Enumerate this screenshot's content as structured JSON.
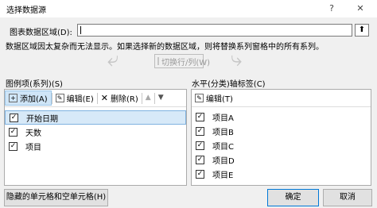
{
  "dialog": {
    "title": "选择数据源",
    "help_glyph": "?",
    "close_glyph": "✕"
  },
  "range": {
    "label": "图表数据区域(D):",
    "value": "",
    "collapse_glyph": "⬆"
  },
  "hint": "数据区域因太复杂而无法显示。如果选择新的数据区域，则将替换系列窗格中的所有系列。",
  "switch_button": {
    "label": "切换行/列(W)"
  },
  "legend": {
    "label": "图例项(系列)(S)",
    "add_label": "添加(A)",
    "edit_label": "编辑(E)",
    "delete_label": "删除(R)",
    "up_glyph": "▲",
    "down_glyph": "▼",
    "items": [
      {
        "label": "开始日期",
        "checked": true
      },
      {
        "label": "天数",
        "checked": true
      },
      {
        "label": "项目",
        "checked": true
      }
    ]
  },
  "axis": {
    "label": "水平(分类)轴标签(C)",
    "edit_label": "编辑(T)",
    "items": [
      {
        "label": "项目A",
        "checked": true
      },
      {
        "label": "项目B",
        "checked": true
      },
      {
        "label": "项目C",
        "checked": true
      },
      {
        "label": "项目D",
        "checked": true
      },
      {
        "label": "项目E",
        "checked": true
      }
    ]
  },
  "buttons": {
    "hidden_cells": "隐藏的单元格和空单元格(H)",
    "ok": "确定",
    "cancel": "取消"
  },
  "check_glyph": "✓"
}
